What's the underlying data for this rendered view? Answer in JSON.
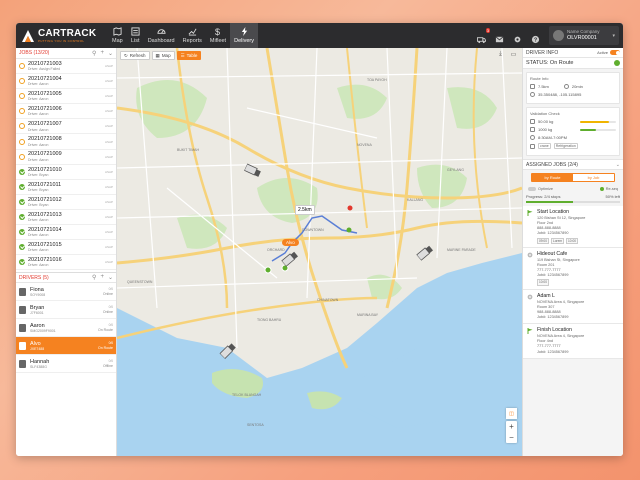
{
  "app": {
    "brand": "CARTRACK",
    "tagline": "PUTTING YOU IN CONTROL",
    "accent": "#f58220"
  },
  "nav": [
    {
      "label": "Map",
      "icon": "map-icon"
    },
    {
      "label": "List",
      "icon": "list-icon"
    },
    {
      "label": "Dashboard",
      "icon": "dashboard-icon"
    },
    {
      "label": "Reports",
      "icon": "reports-icon"
    },
    {
      "label": "Mifleet",
      "icon": "dollar-icon"
    },
    {
      "label": "Delivery",
      "icon": "bolt-icon",
      "active": true
    }
  ],
  "topbar": {
    "notification_count": "3",
    "company_name": "Name Company",
    "company_code": "OLVR00001"
  },
  "jobs": {
    "header": "JOBS (13/20)",
    "items": [
      {
        "id": "20210721003",
        "sub": "Driver: Assign Failed",
        "meta": "ASAP",
        "status": "pending"
      },
      {
        "id": "20210721004",
        "sub": "Driver: Aaron",
        "meta": "ASAP",
        "status": "pending"
      },
      {
        "id": "20210721005",
        "sub": "Driver: Aaron",
        "meta": "ASAP",
        "status": "pending"
      },
      {
        "id": "20210721006",
        "sub": "Driver: Aaron",
        "meta": "ASAP",
        "status": "pending"
      },
      {
        "id": "20210721007",
        "sub": "Driver: Aaron",
        "meta": "ASAP",
        "status": "pending"
      },
      {
        "id": "20210721008",
        "sub": "Driver: Aaron",
        "meta": "ASAP",
        "status": "pending"
      },
      {
        "id": "20210721009",
        "sub": "Driver: Aaron",
        "meta": "ASAP",
        "status": "pending"
      },
      {
        "id": "20210721010",
        "sub": "Driver: Bryan",
        "meta": "ASAP",
        "status": "done"
      },
      {
        "id": "20210721011",
        "sub": "Driver: Bryan",
        "meta": "ASAP",
        "status": "done"
      },
      {
        "id": "20210721012",
        "sub": "Driver: Bryan",
        "meta": "ASAP",
        "status": "done"
      },
      {
        "id": "20210721013",
        "sub": "Driver: Aaron",
        "meta": "ASAP",
        "status": "done"
      },
      {
        "id": "20210721014",
        "sub": "Driver: Aaron",
        "meta": "ASAP",
        "status": "done"
      },
      {
        "id": "20210721015",
        "sub": "Driver: Aaron",
        "meta": "ASAP",
        "status": "done"
      },
      {
        "id": "20210721016",
        "sub": "Driver: Aaron",
        "meta": "ASAP",
        "status": "done"
      }
    ]
  },
  "drivers": {
    "header": "DRIVERS (5)",
    "items": [
      {
        "name": "Fiona",
        "id": "SOY9008",
        "meta": "0/6",
        "status": "Online"
      },
      {
        "name": "Bryan",
        "id": "J7F6001",
        "meta": "0/6",
        "status": "Online"
      },
      {
        "name": "Aaron",
        "id": "SMG2009F9001",
        "meta": "0/6",
        "status": "On Route"
      },
      {
        "name": "Alvo",
        "id": "JXE7488",
        "meta": "0/6",
        "status": "On Route",
        "active": true
      },
      {
        "name": "Hannah",
        "id": "SLF4388G",
        "meta": "0/6",
        "status": "Offline"
      }
    ]
  },
  "map": {
    "refresh_label": "Refresh",
    "map_label": "Map",
    "table_label": "Table",
    "distance": "2.5km",
    "driver_tag": "Alvo",
    "places": [
      "QUEENSTOWN",
      "TIONG BAHRU",
      "TELOK BLANGAH",
      "CHINATOWN",
      "DOWNTOWN",
      "MARINA BAY",
      "KALLANG",
      "GEYLANG",
      "NOVENA",
      "BUKIT TIMAH",
      "TOA PAYOH",
      "ORCHARD",
      "SENTOSA",
      "MARINE PARADE"
    ]
  },
  "driver_info": {
    "header": "DRIVER INFO",
    "active_label": "Active",
    "status": "STATUS: On Route",
    "route_title": "Route Info",
    "route_distance": "7.5km",
    "route_time": "20min",
    "route_coords": "35.350488, -105.115895",
    "validation_title": "Validation Check",
    "weight": "50.00 kg",
    "weight_fill": 0.8,
    "volume": "1000 kg",
    "volume_fill": 0.45,
    "window": "8:30AM-7:00PM",
    "chip_1": "crane",
    "chip_2": "Refrigeration"
  },
  "assigned": {
    "header": "ASSIGNED JOBS (2/4)",
    "tab_route": "by Route",
    "tab_job": "by Job",
    "optimize_label": "Optimize",
    "reorder_label": "Re-seq",
    "progress_label": "Progress: 2/4 stops",
    "progress_value": "50% left",
    "progress_fill": 0.5,
    "stops": [
      {
        "title": "Start Location",
        "lines": [
          "120 Bishan St 12, Singapore",
          "Floor 2nd",
          "888-888-8888",
          "Job#: 1234567890"
        ],
        "tags": [
          "09:00",
          "Lorem",
          "10:00"
        ],
        "icon": "flag-icon"
      },
      {
        "title": "Hideout Cafe",
        "lines": [
          "119 Bishan St, Singapore",
          "Room 201",
          "777-777-7777",
          "Job#: 1234567899"
        ],
        "tags": [
          "10:00"
        ],
        "icon": "pin-icon"
      },
      {
        "title": "Adam L",
        "lines": [
          "NOVENA Area 4, Singapore",
          "Room 307",
          "988-888-8888",
          "Job#: 1234567899"
        ],
        "tags": [],
        "icon": "pin-icon"
      },
      {
        "title": "Finish Location",
        "lines": [
          "NOVENA Area 4, Singapore",
          "Floor 4nd",
          "777-777-7777",
          "Job#: 1234567899"
        ],
        "tags": [],
        "icon": "flag-icon"
      }
    ]
  }
}
